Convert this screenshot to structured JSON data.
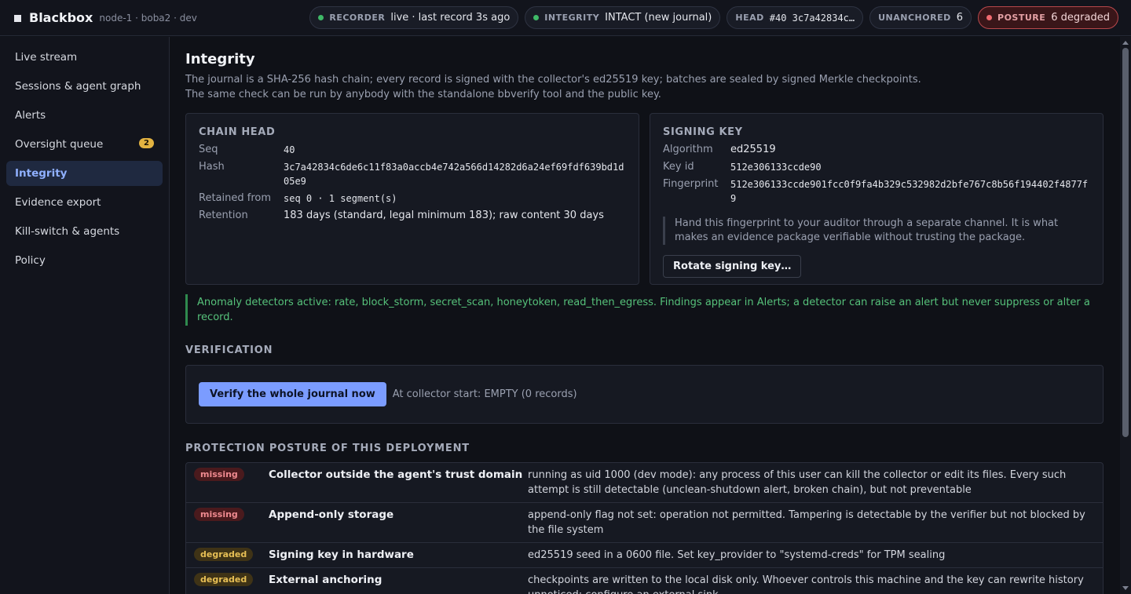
{
  "brand": {
    "name": "Blackbox",
    "node": "node-1 · boba2 · dev"
  },
  "status": {
    "recorder": {
      "key": "RECORDER",
      "value": "live · last record 3s ago",
      "color": "#3fb967"
    },
    "integrity": {
      "key": "INTEGRITY",
      "value": "INTACT (new journal)",
      "color": "#3fb967"
    },
    "head": {
      "key": "HEAD",
      "value": "#40 3c7a42834c…"
    },
    "unanchored": {
      "key": "UNANCHORED",
      "value": "6"
    },
    "posture": {
      "key": "POSTURE",
      "value": "6 degraded",
      "color": "#f06a6f"
    }
  },
  "sidebar": {
    "items": [
      {
        "label": "Live stream"
      },
      {
        "label": "Sessions & agent graph"
      },
      {
        "label": "Alerts"
      },
      {
        "label": "Oversight queue",
        "badge": "2"
      },
      {
        "label": "Integrity",
        "active": true
      },
      {
        "label": "Evidence export"
      },
      {
        "label": "Kill-switch & agents"
      },
      {
        "label": "Policy"
      }
    ]
  },
  "page": {
    "title": "Integrity",
    "desc_line1": "The journal is a SHA-256 hash chain; every record is signed with the collector's ed25519 key; batches are sealed by signed Merkle checkpoints.",
    "desc_line2": "The same check can be run by anybody with the standalone bbverify tool and the public key."
  },
  "chain_head": {
    "title": "CHAIN HEAD",
    "seq_label": "Seq",
    "seq": "40",
    "hash_label": "Hash",
    "hash": "3c7a42834c6de6c11f83a0accb4e742a566d14282d6a24ef69fdf639bd1d05e9",
    "retained_label": "Retained from",
    "retained": "seq 0 · 1 segment(s)",
    "retention_label": "Retention",
    "retention": "183 days (standard, legal minimum 183); raw content 30 days"
  },
  "signing_key": {
    "title": "SIGNING KEY",
    "algorithm_label": "Algorithm",
    "algorithm": "ed25519",
    "keyid_label": "Key id",
    "keyid": "512e306133ccde90",
    "fingerprint_label": "Fingerprint",
    "fingerprint": "512e306133ccde901fcc0f9fa4b329c532982d2bfe767c8b56f194402f4877f9",
    "note": "Hand this fingerprint to your auditor through a separate channel. It is what makes an evidence package verifiable without trusting the package.",
    "rotate_label": "Rotate signing key…"
  },
  "anomaly": "Anomaly detectors active: rate, block_storm, secret_scan, honeytoken, read_then_egress. Findings appear in Alerts; a detector can raise an alert but never suppress or alter a record.",
  "verification": {
    "title": "VERIFICATION",
    "button": "Verify the whole journal now",
    "status": "At collector start: EMPTY (0 records)"
  },
  "posture": {
    "title": "PROTECTION POSTURE OF THIS DEPLOYMENT",
    "rows": [
      {
        "state": "missing",
        "name": "Collector outside the agent's trust domain",
        "desc": "running as uid 1000 (dev mode): any process of this user can kill the collector or edit its files. Every such attempt is still detectable (unclean-shutdown alert, broken chain), but not preventable"
      },
      {
        "state": "missing",
        "name": "Append-only storage",
        "desc": "append-only flag not set: operation not permitted. Tampering is detectable by the verifier but not blocked by the file system"
      },
      {
        "state": "degraded",
        "name": "Signing key in hardware",
        "desc": "ed25519 seed in a 0600 file. Set key_provider to \"systemd-creds\" for TPM sealing"
      },
      {
        "state": "degraded",
        "name": "External anchoring",
        "desc": "checkpoints are written to the local disk only. Whoever controls this machine and the key can rewrite history unnoticed; configure an external sink"
      }
    ]
  }
}
